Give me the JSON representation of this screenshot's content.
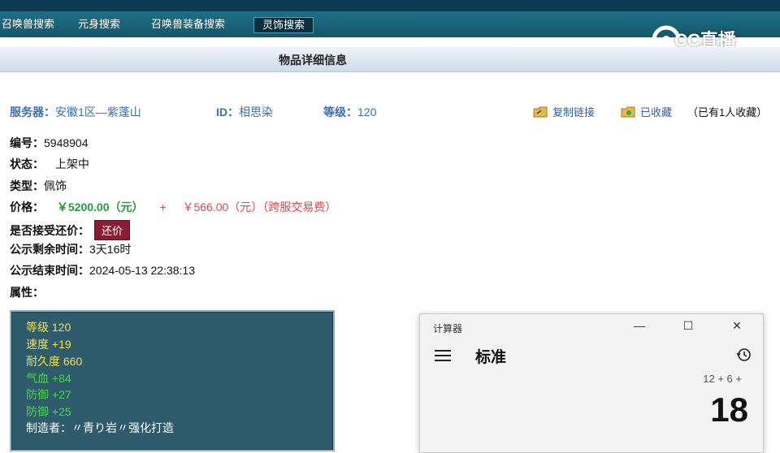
{
  "tabs": [
    {
      "label": "召唤兽搜索"
    },
    {
      "label": "元身搜索"
    },
    {
      "label": "召唤兽装备搜索"
    },
    {
      "label": "灵饰搜索"
    }
  ],
  "logo": {
    "text": "CC直播"
  },
  "page_title": "物品详细信息",
  "server": {
    "server_label": "服务器：",
    "server_value": "安徽1区—紫蓬山",
    "id_label": "ID：",
    "id_value": "相思染",
    "level_label": "等级：",
    "level_value": "120"
  },
  "actions": {
    "copy_link": "复制链接",
    "favorited": "已收藏",
    "fav_count": "（已有1人收藏）"
  },
  "details": {
    "id_label": "编号：",
    "id_value": "5948904",
    "status_label": "状态：",
    "status_value": "上架中",
    "type_label": "类型：",
    "type_value": "佩饰",
    "price_label": "价格：",
    "price_value": "￥5200.00（元）",
    "plus": "+",
    "fee_value": "￥566.00（元）（跨服交易费）",
    "counter_label": "是否接受还价：",
    "counter_button": "还价",
    "remain_label": "公示剩余时间：",
    "remain_value": "3天16时",
    "end_label": "公示结束时间：",
    "end_value": "2024-05-13 22:38:13",
    "attr_label": "属性："
  },
  "attributes": [
    {
      "text": "等级 120",
      "color": "#f0e04b"
    },
    {
      "text": "速度 +19",
      "color": "#f0e04b"
    },
    {
      "text": "耐久度 660",
      "color": "#f0e04b"
    },
    {
      "text": "气血 +84",
      "color": "#47d747"
    },
    {
      "text": "防御 +27",
      "color": "#47d747"
    },
    {
      "text": "防御 +25",
      "color": "#47d747"
    },
    {
      "text": "制造者：〃青り岩〃强化打造",
      "color": "#ffffff"
    }
  ],
  "calculator": {
    "title": "计算器",
    "mode": "标准",
    "expression": "12 + 6 +",
    "result": "18"
  }
}
